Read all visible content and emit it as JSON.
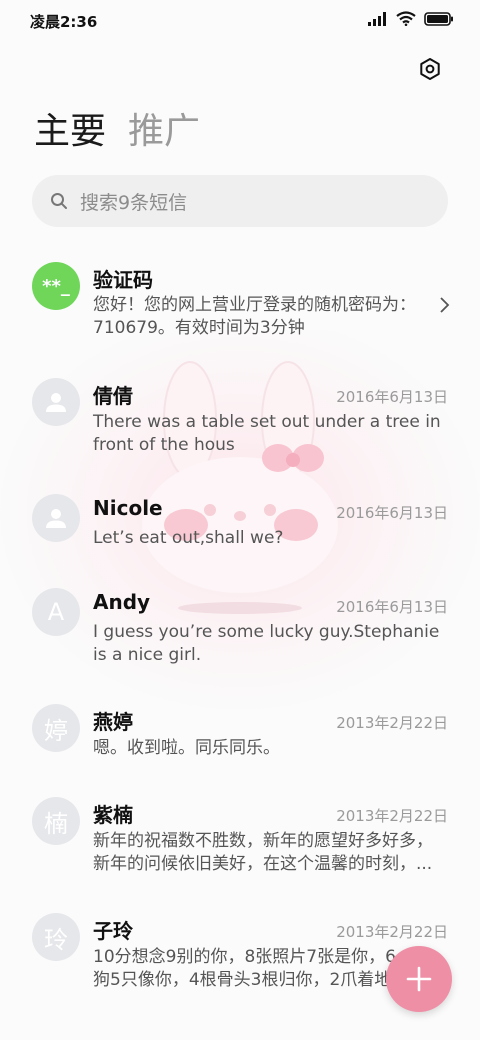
{
  "status": {
    "time": "凌晨2:36"
  },
  "tabs": [
    {
      "label": "主要"
    },
    {
      "label": "推广"
    }
  ],
  "search": {
    "placeholder": "搜索9条短信"
  },
  "messages": [
    {
      "avatar": "**_",
      "name": "验证码",
      "date": "",
      "preview": "您好！您的网上营业厅登录的随机密码为：\n710679。有效时间为3分钟"
    },
    {
      "avatar": "",
      "name": "倩倩",
      "date": "2016年6月13日",
      "preview": "There was a table set out under a tree in\nfront of the hous"
    },
    {
      "avatar": "",
      "name": "Nicole",
      "date": "2016年6月13日",
      "preview": "Let’s eat out,shall we?"
    },
    {
      "avatar": "A",
      "name": "Andy",
      "date": "2016年6月13日",
      "preview": "I guess you’re some lucky guy.Stephanie\nis a nice girl."
    },
    {
      "avatar": "婷",
      "name": "燕婷",
      "date": "2013年2月22日",
      "preview": "嗯。收到啦。同乐同乐。"
    },
    {
      "avatar": "楠",
      "name": "紫楠",
      "date": "2013年2月22日",
      "preview": "新年的祝福数不胜数，新年的愿望好多好多，\n新年的问候依旧美好，在这个温馨的时刻，..."
    },
    {
      "avatar": "玲",
      "name": "子玲",
      "date": "2013年2月22日",
      "preview": "10分想念9别的你，8张照片7张是你，6\n狗5只像你，4根骨头3根归你，2爪着地"
    }
  ],
  "colors": {
    "accent_fab": "#ef8fa6",
    "code_avatar": "#6fd65a"
  },
  "icons": [
    "signal-icon",
    "wifi-icon",
    "battery-icon",
    "settings-icon",
    "search-icon",
    "chevron-right-icon",
    "person-icon",
    "plus-icon"
  ]
}
